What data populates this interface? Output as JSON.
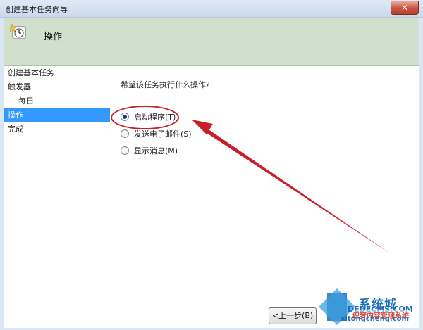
{
  "window": {
    "title": "创建基本任务向导",
    "close_glyph": "✕"
  },
  "header": {
    "title": "操作",
    "icon": "scheduled-task-clock-icon"
  },
  "steps": [
    {
      "label": "创建基本任务"
    },
    {
      "label": "触发器"
    },
    {
      "label": "每日"
    },
    {
      "label": "操作"
    },
    {
      "label": "完成"
    }
  ],
  "main": {
    "question": "希望该任务执行什么操作?",
    "options": [
      {
        "label": "启动程序(T)",
        "selected": true
      },
      {
        "label": "发送电子邮件(S)",
        "selected": false
      },
      {
        "label": "显示消息(M)",
        "selected": false
      }
    ]
  },
  "buttons": {
    "back_label": "<上一步(B)"
  },
  "annotation": {
    "color": "#c8202b"
  },
  "watermark": {
    "brand": "系统城",
    "site": "织梦内容管理系统",
    "cms": "DEDECMS.COM",
    "url": "xitongcheng.com"
  },
  "colors": {
    "header_bg": "#cfe0cc",
    "selection": "#3399ff",
    "frame": "#d9e7f5"
  }
}
